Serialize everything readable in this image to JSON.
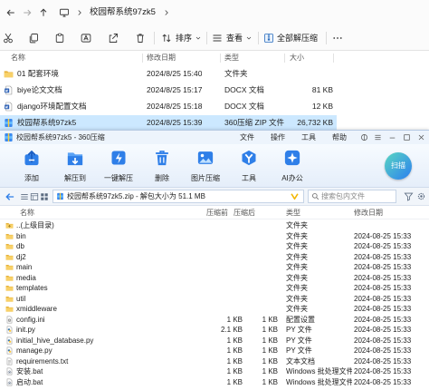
{
  "explorer": {
    "breadcrumb": [
      "校园帮系统97zk5"
    ],
    "toolbar": {
      "sort_label": "排序",
      "view_label": "查看",
      "extract_all_label": "全部解压缩"
    },
    "columns": {
      "name": "名称",
      "date": "修改日期",
      "type": "类型",
      "size": "大小"
    },
    "files": [
      {
        "name": "01 配套环境",
        "date": "2024/8/25 15:40",
        "type": "文件夹",
        "size": "",
        "icon": "folder-icon",
        "selected": false
      },
      {
        "name": "biye论文文档",
        "date": "2024/8/25 15:17",
        "type": "DOCX 文档",
        "size": "81 KB",
        "icon": "docx-icon",
        "selected": false
      },
      {
        "name": "django环境配置文档",
        "date": "2024/8/25 15:18",
        "type": "DOCX 文档",
        "size": "12 KB",
        "icon": "docx-icon",
        "selected": false
      },
      {
        "name": "校园帮系统97zk5",
        "date": "2024/8/25 15:39",
        "type": "360压缩 ZIP 文件",
        "size": "26,732 KB",
        "icon": "zip-icon",
        "selected": true
      }
    ]
  },
  "zip_window": {
    "title": "校园帮系统97zk5 - 360压缩",
    "menu": [
      "文件",
      "操作",
      "工具",
      "帮助"
    ],
    "toolbar": [
      {
        "label": "添加",
        "icon": "add-icon"
      },
      {
        "label": "解压到",
        "icon": "extract-to-icon"
      },
      {
        "label": "一键解压",
        "icon": "one-click-extract-icon"
      },
      {
        "label": "删除",
        "icon": "zip-delete-icon"
      },
      {
        "label": "图片压缩",
        "icon": "image-compress-icon"
      },
      {
        "label": "工具",
        "icon": "tools-icon"
      },
      {
        "label": "AI办公",
        "icon": "ai-office-icon"
      }
    ],
    "scan_label": "扫描",
    "address": "校园帮系统97zk5.zip - 解包大小为 51.1 MB",
    "search_placeholder": "搜索包内文件",
    "columns": {
      "name": "名称",
      "before": "压缩前",
      "after": "压缩后",
      "type": "类型",
      "date": "修改日期"
    },
    "entries": [
      {
        "name": "..(上级目录)",
        "before": "",
        "after": "",
        "type": "文件夹",
        "date": "",
        "icon": "parent-folder-icon"
      },
      {
        "name": "bin",
        "before": "",
        "after": "",
        "type": "文件夹",
        "date": "2024-08-25 15:33",
        "icon": "folder-icon"
      },
      {
        "name": "db",
        "before": "",
        "after": "",
        "type": "文件夹",
        "date": "2024-08-25 15:33",
        "icon": "folder-icon"
      },
      {
        "name": "dj2",
        "before": "",
        "after": "",
        "type": "文件夹",
        "date": "2024-08-25 15:33",
        "icon": "folder-icon"
      },
      {
        "name": "main",
        "before": "",
        "after": "",
        "type": "文件夹",
        "date": "2024-08-25 15:33",
        "icon": "folder-icon"
      },
      {
        "name": "media",
        "before": "",
        "after": "",
        "type": "文件夹",
        "date": "2024-08-25 15:33",
        "icon": "folder-icon"
      },
      {
        "name": "templates",
        "before": "",
        "after": "",
        "type": "文件夹",
        "date": "2024-08-25 15:33",
        "icon": "folder-icon"
      },
      {
        "name": "util",
        "before": "",
        "after": "",
        "type": "文件夹",
        "date": "2024-08-25 15:33",
        "icon": "folder-icon"
      },
      {
        "name": "xmiddleware",
        "before": "",
        "after": "",
        "type": "文件夹",
        "date": "2024-08-25 15:33",
        "icon": "folder-icon"
      },
      {
        "name": "config.ini",
        "before": "1 KB",
        "after": "1 KB",
        "type": "配置设置",
        "date": "2024-08-25 15:33",
        "icon": "ini-file-icon"
      },
      {
        "name": "init.py",
        "before": "2.1 KB",
        "after": "1 KB",
        "type": "PY 文件",
        "date": "2024-08-25 15:33",
        "icon": "python-file-icon"
      },
      {
        "name": "initial_hive_database.py",
        "before": "1 KB",
        "after": "1 KB",
        "type": "PY 文件",
        "date": "2024-08-25 15:33",
        "icon": "python-file-icon"
      },
      {
        "name": "manage.py",
        "before": "1 KB",
        "after": "1 KB",
        "type": "PY 文件",
        "date": "2024-08-25 15:33",
        "icon": "python-file-icon"
      },
      {
        "name": "requirements.txt",
        "before": "1 KB",
        "after": "1 KB",
        "type": "文本文档",
        "date": "2024-08-25 15:33",
        "icon": "text-file-icon"
      },
      {
        "name": "安装.bat",
        "before": "1 KB",
        "after": "1 KB",
        "type": "Windows 批处理文件",
        "date": "2024-08-25 15:33",
        "icon": "bat-file-icon"
      },
      {
        "name": "启动.bat",
        "before": "1 KB",
        "after": "1 KB",
        "type": "Windows 批处理文件",
        "date": "2024-08-25 15:33",
        "icon": "bat-file-icon"
      }
    ]
  },
  "colors": {
    "selected_row": "#cce8ff",
    "zip_toolbar_icon": "#2f7fe8",
    "folder": "#f8d169",
    "scan_button": "#2c7fef"
  }
}
